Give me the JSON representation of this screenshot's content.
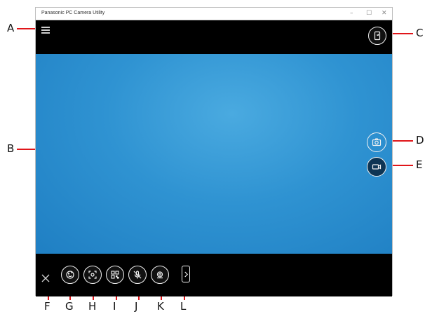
{
  "window": {
    "title": "Panasonic PC Camera Utility",
    "controls": {
      "minimize": "–",
      "maximize": "☐",
      "close": "✕"
    }
  },
  "callouts": {
    "A": "A",
    "B": "B",
    "C": "C",
    "D": "D",
    "E": "E",
    "F": "F",
    "G": "G",
    "H": "H",
    "I": "I",
    "J": "J",
    "K": "K",
    "L": "L"
  },
  "icons": {
    "menu": "hamburger-menu-icon",
    "switch_camera": "switch-camera-icon",
    "capture_photo": "camera-icon",
    "record_video": "video-camera-icon",
    "close": "close-icon",
    "face_detect": "face-icon",
    "scan_frame": "scan-frame-icon",
    "qr_code": "qr-code-icon",
    "mic_mute": "microphone-mute-icon",
    "settings": "settings-icon",
    "more": "chevron-right-icon"
  },
  "colors": {
    "preview_blue": "#2f93d2",
    "callout_line": "#e0161a",
    "bar_background": "#000000"
  }
}
